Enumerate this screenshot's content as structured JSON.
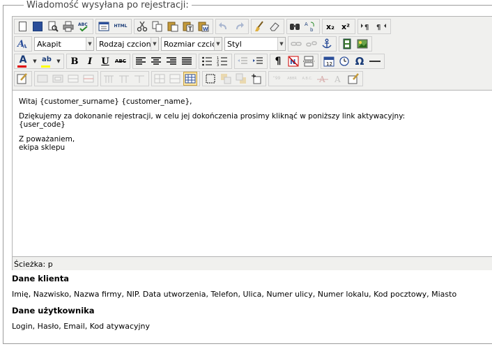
{
  "fieldset": {
    "legend": "Wiadomość wysyłana po rejestracji:"
  },
  "toolbar": {
    "row1": [
      "new-document-icon",
      "save-icon",
      "print-preview-icon",
      "print-icon",
      "spellcheck-icon",
      "source-icon",
      "html-icon",
      "cut-icon",
      "copy-icon",
      "paste-icon",
      "paste-text-icon",
      "paste-word-icon",
      "undo-icon",
      "redo-icon",
      "cleanup-icon",
      "eraser-icon",
      "find-icon",
      "replace-icon",
      "subscript-icon",
      "superscript-icon",
      "ltr-icon",
      "rtl-icon"
    ],
    "subscript_label": "x₂",
    "superscript_label": "x²",
    "html_label": "HTML",
    "styles_icon": "styles-icon",
    "format_select": "Akapit",
    "font_select": "Rodzaj czcionki",
    "size_select": "Rozmiar czcionki",
    "style_select": "Styl",
    "bold_label": "B",
    "italic_label": "I",
    "underline_label": "U",
    "strike_label": "ABC",
    "text_color_label": "A",
    "highlight_label": "ab",
    "omega_label": "Ω",
    "paragraph_label": "¶"
  },
  "colors": {
    "text_color_bar": "#e00000",
    "highlight_bar": "#ffff00",
    "active_button": "#ffe7a1"
  },
  "content": {
    "line1": "Witaj {customer_surname} {customer_name},",
    "line2": "Dziękujemy za dokonanie rejestracji, w celu jej dokończenia prosimy kliknąć w poniższy link aktywacyjny:\n{user_code}",
    "line3": "Z poważaniem,\nekipa sklepu"
  },
  "statusbar": {
    "path": "Ścieżka: p"
  },
  "client_section": {
    "title": "Dane klienta",
    "fields": "Imię, Nazwisko, Nazwa firmy, NIP. Data utworzenia, Telefon, Ulica, Numer ulicy, Numer lokalu, Kod pocztowy, Miasto"
  },
  "user_section": {
    "title": "Dane użytkownika",
    "fields": "Login, Hasło, Email, Kod atywacyjny"
  }
}
